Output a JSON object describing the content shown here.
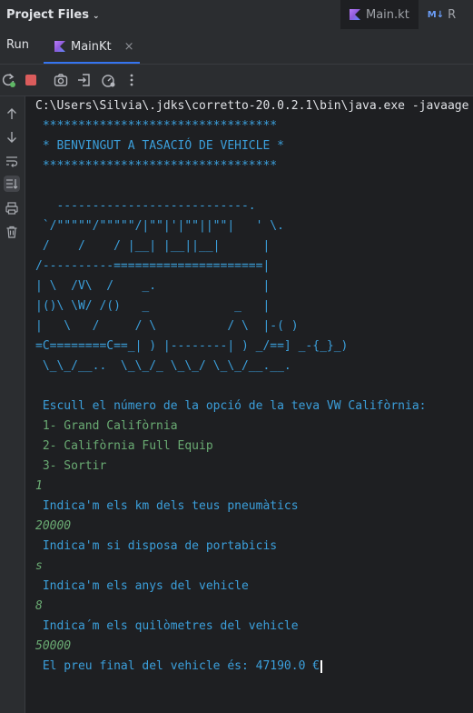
{
  "header": {
    "project_title": "Project Files",
    "tabs": [
      {
        "label": "Main.kt",
        "icon": "kotlin-file-icon"
      },
      {
        "label": "R",
        "icon": "markdown-file-icon"
      }
    ]
  },
  "run": {
    "label": "Run",
    "tab_label": "MainKt",
    "close": "×"
  },
  "toolbar": {
    "icons": [
      "rerun-icon",
      "stop-icon",
      "screenshot-icon",
      "exit-icon",
      "profiler-icon",
      "more-options-icon"
    ]
  },
  "sidebar": {
    "icons": [
      "scroll-up-icon",
      "scroll-down-icon",
      "soft-wrap-icon",
      "scroll-to-end-icon",
      "print-icon",
      "trash-icon"
    ]
  },
  "console": {
    "command": "C:\\Users\\Silvia\\.jdks\\corretto-20.0.2.1\\bin\\java.exe -javaage",
    "banner_top": " *********************************",
    "banner_title": " * BENVINGUT A TASACIÓ DE VEHICLE *",
    "banner_bottom": " *********************************",
    "art": [
      "   ---------------------------.",
      " `/\"\"\"\"\"/\"\"\"\"\"/|\"\"|'|\"\"||\"\"|   ' \\.",
      " /    /    / |__| |__||__|      |",
      "/----------=====================|",
      "| \\  /V\\  /    _.               |",
      "|()\\ \\W/ /()   _            _   |",
      "|   \\   /     / \\          / \\  |-( )",
      "=C========C==_| ) |--------| ) _/==] _-{_}_)",
      " \\_\\_/__..  \\_\\_/_ \\_\\_/ \\_\\_/__.__."
    ],
    "prompt_model": " Escull el número de la opció de la teva VW Califòrnia:",
    "options": [
      " 1- Grand Califòrnia",
      " 2- Califòrnia Full Equip",
      " 3- Sortir"
    ],
    "input_model": "1",
    "prompt_km_tyres": " Indica'm els km dels teus pneumàtics",
    "input_km_tyres": "20000",
    "prompt_bike_rack": " Indica'm si disposa de portabicis",
    "input_bike_rack": "s",
    "prompt_years": " Indica'm els anys del vehicle",
    "input_years": "8",
    "prompt_km": " Indica´m els quilòmetres del vehicle",
    "input_km": "50000",
    "result": " El preu final del vehicle és: 47190.0 €"
  }
}
